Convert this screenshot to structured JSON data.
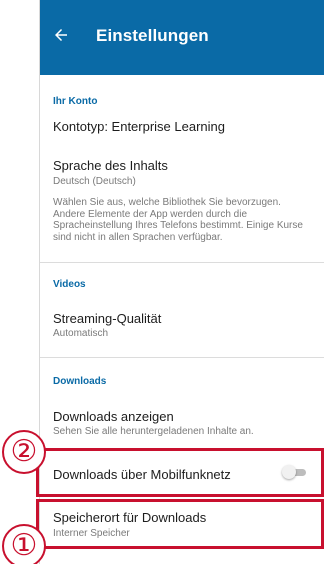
{
  "appbar": {
    "title": "Einstellungen",
    "back_icon": "arrow-left-icon"
  },
  "sections": {
    "account": {
      "header": "Ihr Konto",
      "account_type": "Kontotyp: Enterprise Learning",
      "content_language_title": "Sprache des Inhalts",
      "content_language_value": "Deutsch (Deutsch)",
      "content_language_description": "Wählen Sie aus, welche Bibliothek Sie bevorzugen. Andere Elemente der App werden durch die Spracheinstellung Ihres Telefons bestimmt. Einige Kurse sind nicht in allen Sprachen verfügbar."
    },
    "videos": {
      "header": "Videos",
      "streaming_quality_title": "Streaming-Qualität",
      "streaming_quality_value": "Automatisch"
    },
    "downloads": {
      "header": "Downloads",
      "show_downloads_title": "Downloads anzeigen",
      "show_downloads_sub": "Sehen Sie alle heruntergeladenen Inhalte an.",
      "mobile_downloads_title": "Downloads über Mobilfunknetz",
      "mobile_downloads_enabled": false,
      "storage_title": "Speicherort für Downloads",
      "storage_value": "Interner Speicher"
    }
  },
  "annotations": {
    "badge_1": "①",
    "badge_2": "②"
  },
  "colors": {
    "accent": "#0a6aa6",
    "highlight": "#c8102e"
  }
}
